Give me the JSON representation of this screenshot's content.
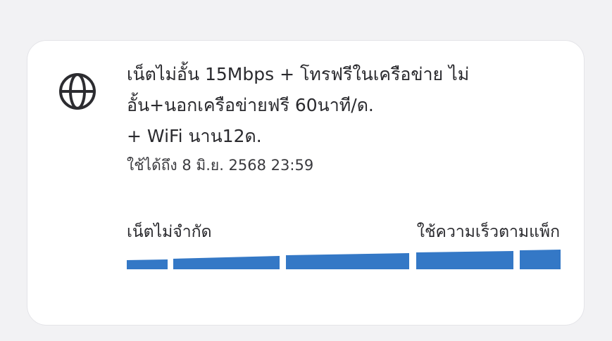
{
  "package": {
    "icon": "globe-icon",
    "title_lines": [
      "เน็ตไม่อั้น 15Mbps + โทรฟรีในเครือข่าย ไม่",
      "อั้น+นอกเครือข่ายฟรี 60นาที/ด.",
      "+ WiFi นาน12ด."
    ],
    "expiry": "ใช้ได้ถึง 8 มิ.ย. 2568 23:59"
  },
  "speed": {
    "left_label": "เน็ตไม่จำกัด",
    "right_label": "ใช้ความเร็วตามแพ็ก",
    "color": "#3478c6"
  }
}
